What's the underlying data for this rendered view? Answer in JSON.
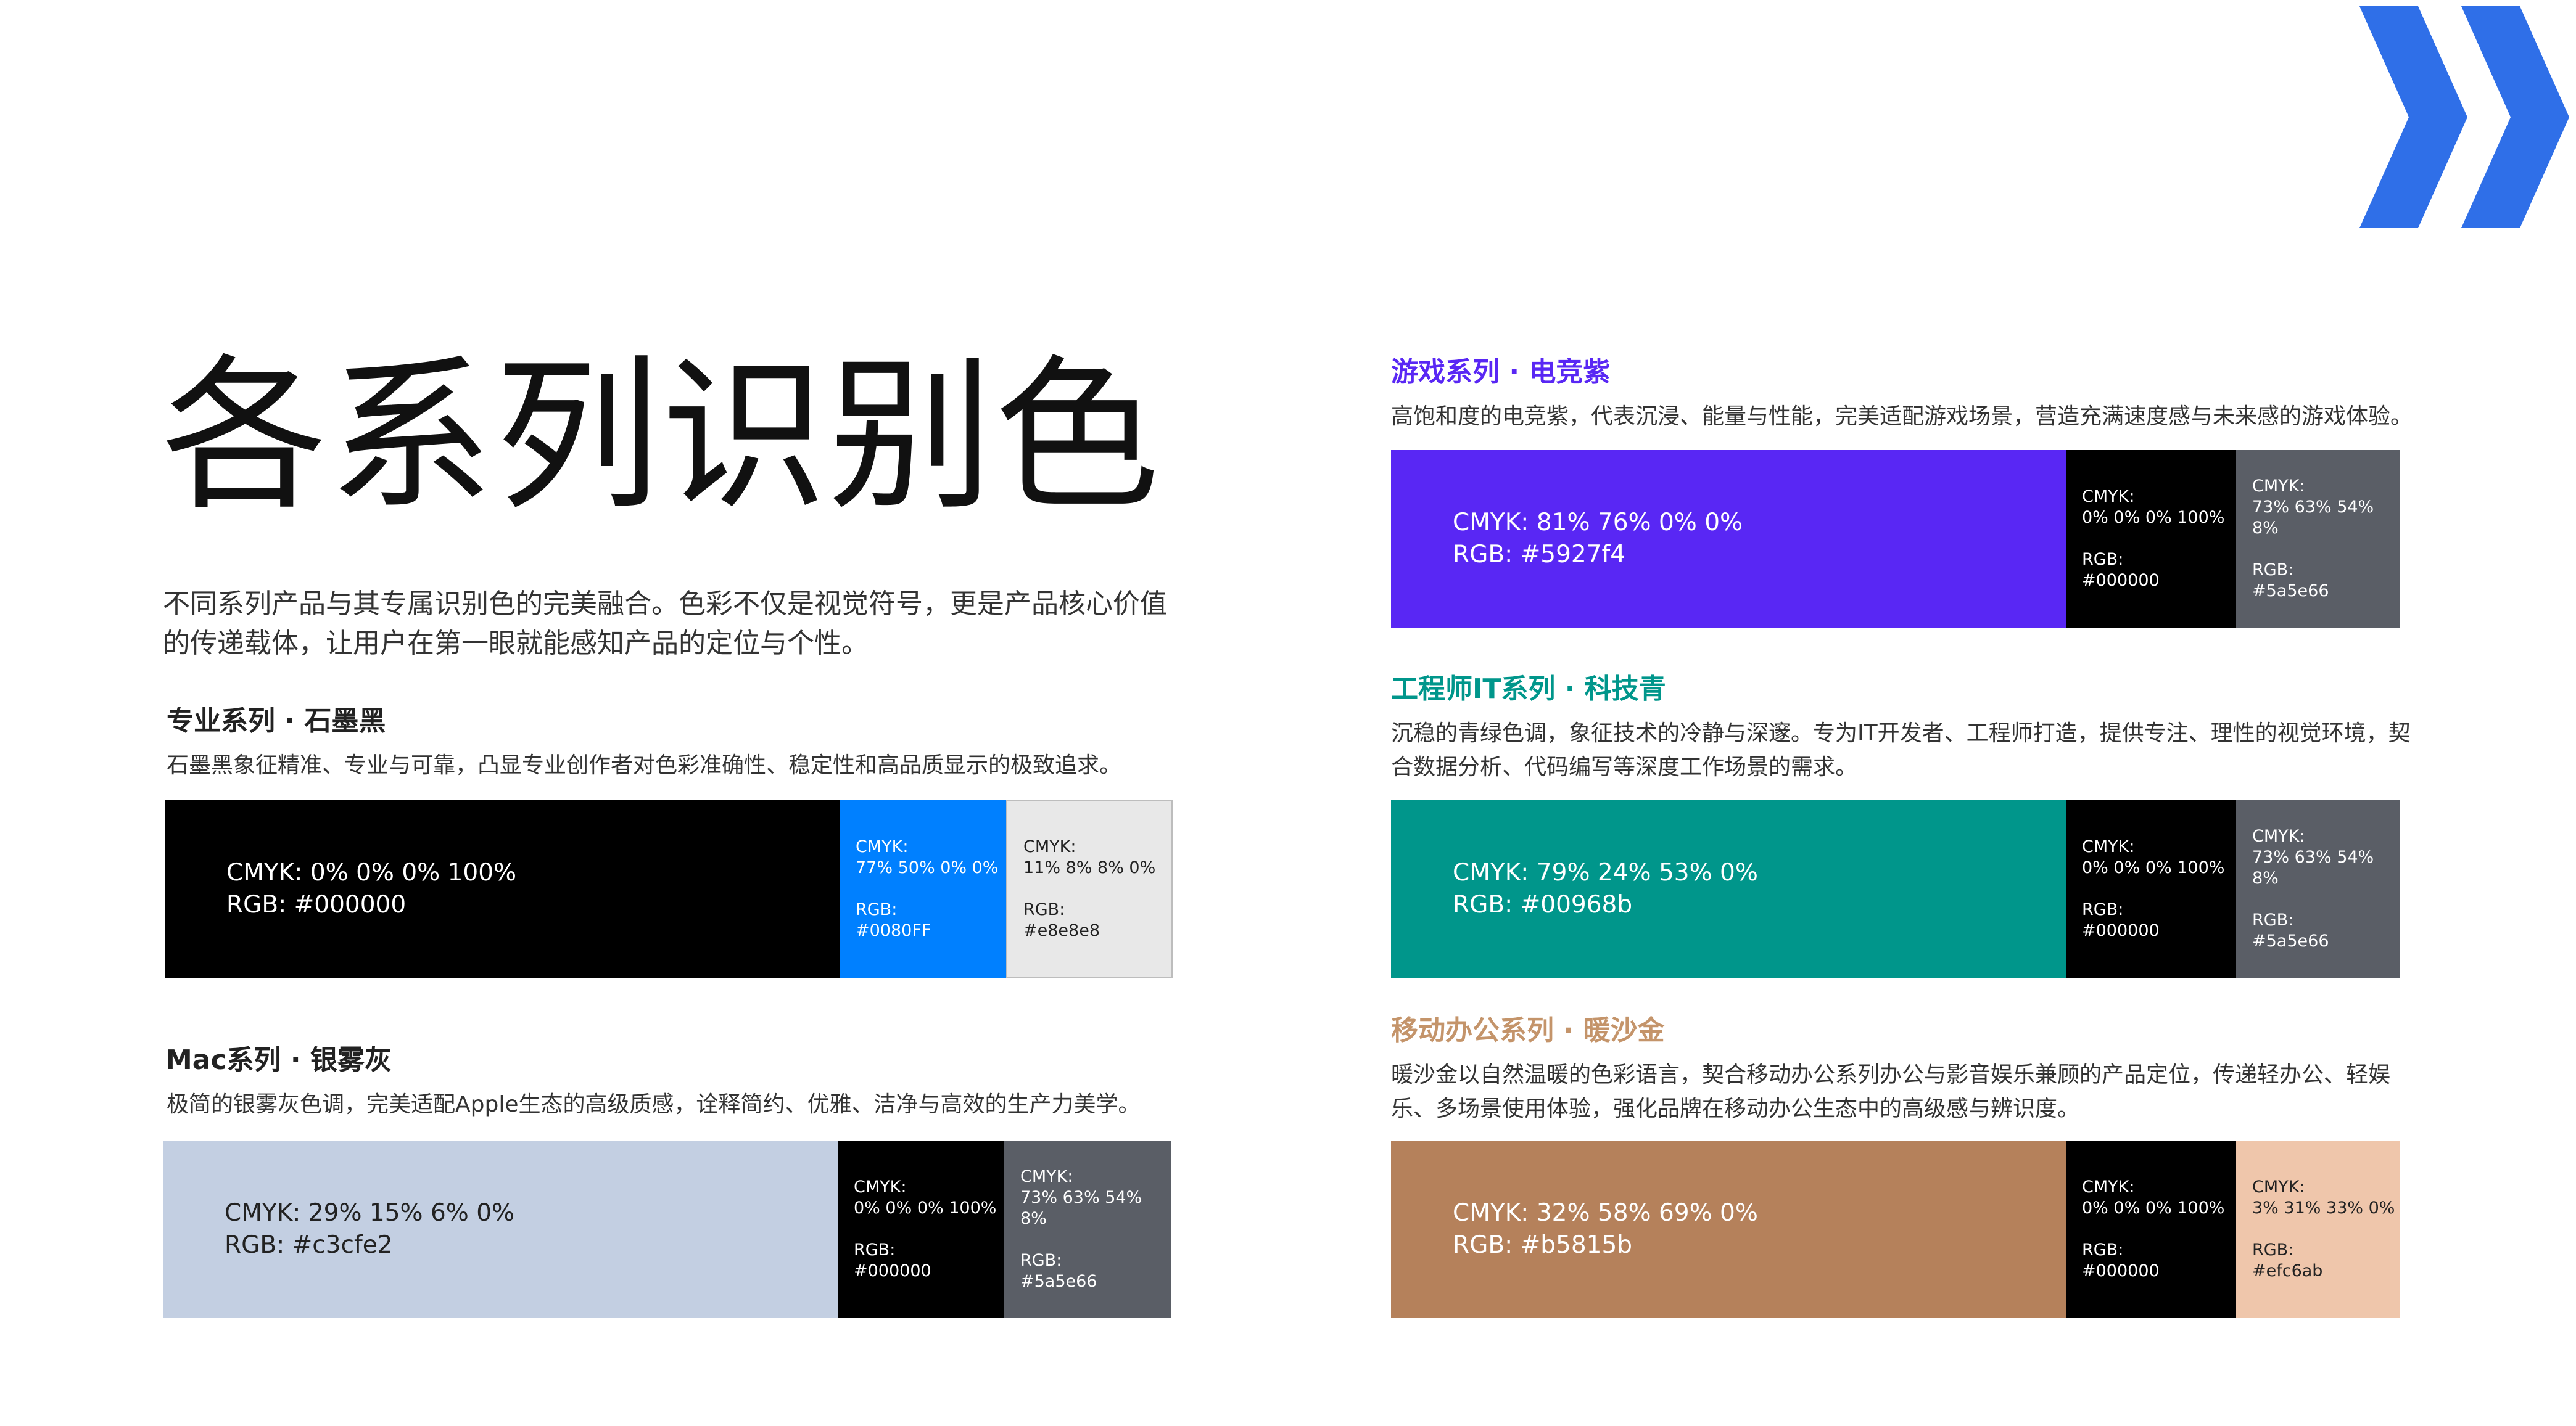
{
  "page": {
    "title": "各系列识别色",
    "intro": "不同系列产品与其专属识别色的完美融合。色彩不仅是视觉符号，更是产品核心价值的传递载体，让用户在第一眼就能感知产品的定位与个性。"
  },
  "series": [
    {
      "title": "专业系列 · 石墨黑",
      "title_color": "#111111",
      "desc": "石墨黑象征精准、专业与可靠，凸显专业创作者对色彩准确性、稳定性和高品质显示的极致追求。",
      "main": {
        "cmyk": "CMYK: 0% 0% 0% 100%",
        "rgb": "RGB: #000000",
        "bg": "#000000"
      },
      "secondary": [
        {
          "cmyk_label": "CMYK:",
          "cmyk": "77% 50% 0% 0%",
          "rgb_label": "RGB:",
          "rgb": "#0080FF",
          "bg": "#0080ff"
        },
        {
          "cmyk_label": "CMYK:",
          "cmyk": "11% 8% 8% 0%",
          "rgb_label": "RGB:",
          "rgb": "#e8e8e8",
          "bg": "#e8e8e8"
        }
      ]
    },
    {
      "title": "Mac系列 · 银雾灰",
      "title_color": "#111111",
      "desc": "极简的银雾灰色调，完美适配Apple生态的高级质感，诠释简约、优雅、洁净与高效的生产力美学。",
      "main": {
        "cmyk": "CMYK: 29% 15% 6% 0%",
        "rgb": "RGB: #c3cfe2",
        "bg": "#c3cfe2"
      },
      "secondary": [
        {
          "cmyk_label": "CMYK:",
          "cmyk": "0% 0% 0% 100%",
          "rgb_label": "RGB:",
          "rgb": "#000000",
          "bg": "#000000"
        },
        {
          "cmyk_label": "CMYK:",
          "cmyk": "73% 63% 54% 8%",
          "rgb_label": "RGB:",
          "rgb": "#5a5e66",
          "bg": "#5a5e66"
        }
      ]
    },
    {
      "title": "游戏系列 · 电竞紫",
      "title_color": "#5927f4",
      "desc": "高饱和度的电竞紫，代表沉浸、能量与性能，完美适配游戏场景，营造充满速度感与未来感的游戏体验。",
      "main": {
        "cmyk": "CMYK: 81% 76% 0% 0%",
        "rgb": "RGB: #5927f4",
        "bg": "#5927f4"
      },
      "secondary": [
        {
          "cmyk_label": "CMYK:",
          "cmyk": "0% 0% 0% 100%",
          "rgb_label": "RGB:",
          "rgb": "#000000",
          "bg": "#000000"
        },
        {
          "cmyk_label": "CMYK:",
          "cmyk": "73% 63% 54% 8%",
          "rgb_label": "RGB:",
          "rgb": "#5a5e66",
          "bg": "#5a5e66"
        }
      ]
    },
    {
      "title": "工程师IT系列 · 科技青",
      "title_color": "#00968b",
      "desc": "沉稳的青绿色调，象征技术的冷静与深邃。专为IT开发者、工程师打造，提供专注、理性的视觉环境，契合数据分析、代码编写等深度工作场景的需求。",
      "main": {
        "cmyk": "CMYK: 79% 24% 53% 0%",
        "rgb": "RGB: #00968b",
        "bg": "#00968b"
      },
      "secondary": [
        {
          "cmyk_label": "CMYK:",
          "cmyk": "0% 0% 0% 100%",
          "rgb_label": "RGB:",
          "rgb": "#000000",
          "bg": "#000000"
        },
        {
          "cmyk_label": "CMYK:",
          "cmyk": "73% 63% 54% 8%",
          "rgb_label": "RGB:",
          "rgb": "#5a5e66",
          "bg": "#5a5e66"
        }
      ]
    },
    {
      "title": "移动办公系列 · 暖沙金",
      "title_color": "#c4946a",
      "desc": "暖沙金以自然温暖的色彩语言，契合移动办公系列办公与影音娱乐兼顾的产品定位，传递轻办公、轻娱乐、多场景使用体验，强化品牌在移动办公生态中的高级感与辨识度。",
      "main": {
        "cmyk": "CMYK: 32% 58% 69% 0%",
        "rgb": "RGB: #b5815b",
        "bg": "#b5815b"
      },
      "secondary": [
        {
          "cmyk_label": "CMYK:",
          "cmyk": "0% 0% 0% 100%",
          "rgb_label": "RGB:",
          "rgb": "#000000",
          "bg": "#000000"
        },
        {
          "cmyk_label": "CMYK:",
          "cmyk": "3% 31% 33% 0%",
          "rgb_label": "RGB:",
          "rgb": "#efc6ab",
          "bg": "#efc6ab"
        }
      ]
    }
  ],
  "decoration": {
    "icon": "double-chevron-right-icon",
    "color": "#2f6fe8"
  }
}
